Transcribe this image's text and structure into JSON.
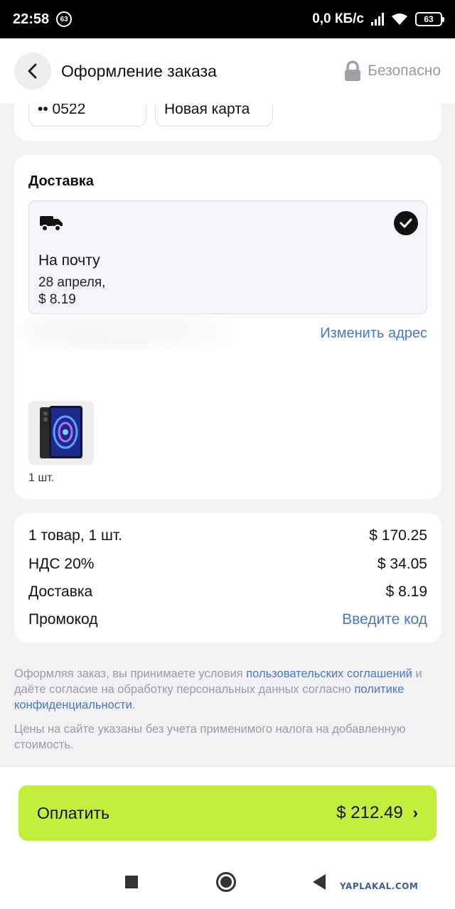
{
  "status_bar": {
    "time": "22:58",
    "notification_badge": "63",
    "network_speed": "0,0 КБ/с",
    "signal_flag": "R",
    "battery": "63"
  },
  "header": {
    "title": "Оформление заказа",
    "secure_label": "Безопасно"
  },
  "payment": {
    "saved_card": "•• 0522",
    "new_card": "Новая карта"
  },
  "delivery": {
    "section_title": "Доставка",
    "option": {
      "title": "На почту",
      "date": "28 апреля,",
      "price": "$ 8.19"
    },
    "change_address": "Изменить адрес",
    "item_quantity": "1 шт."
  },
  "summary": {
    "rows": [
      {
        "label": "1 товар, 1 шт.",
        "value": "$ 170.25"
      },
      {
        "label": "НДС 20%",
        "value": "$ 34.05"
      },
      {
        "label": "Доставка",
        "value": "$ 8.19"
      }
    ],
    "promo_label": "Промокод",
    "promo_action": "Введите код"
  },
  "legal": {
    "text_1": "Оформляя заказ, вы принимаете условия ",
    "link_1": "пользовательских соглашений",
    "text_2": " и даёте согласие на обработку персональных данных согласно ",
    "link_2": "политике конфиденциальности",
    "text_3": ".",
    "tax_note": "Цены на сайте указаны без учета применимого налога на добавленную стоимость."
  },
  "checkout": {
    "pay_label": "Оплатить",
    "total": "$ 212.49"
  },
  "watermark": "YAPLAKAL.COM",
  "colors": {
    "accent_green": "#c3ef3c",
    "link_blue": "#4a78c4",
    "background": "#f2f2f4"
  }
}
